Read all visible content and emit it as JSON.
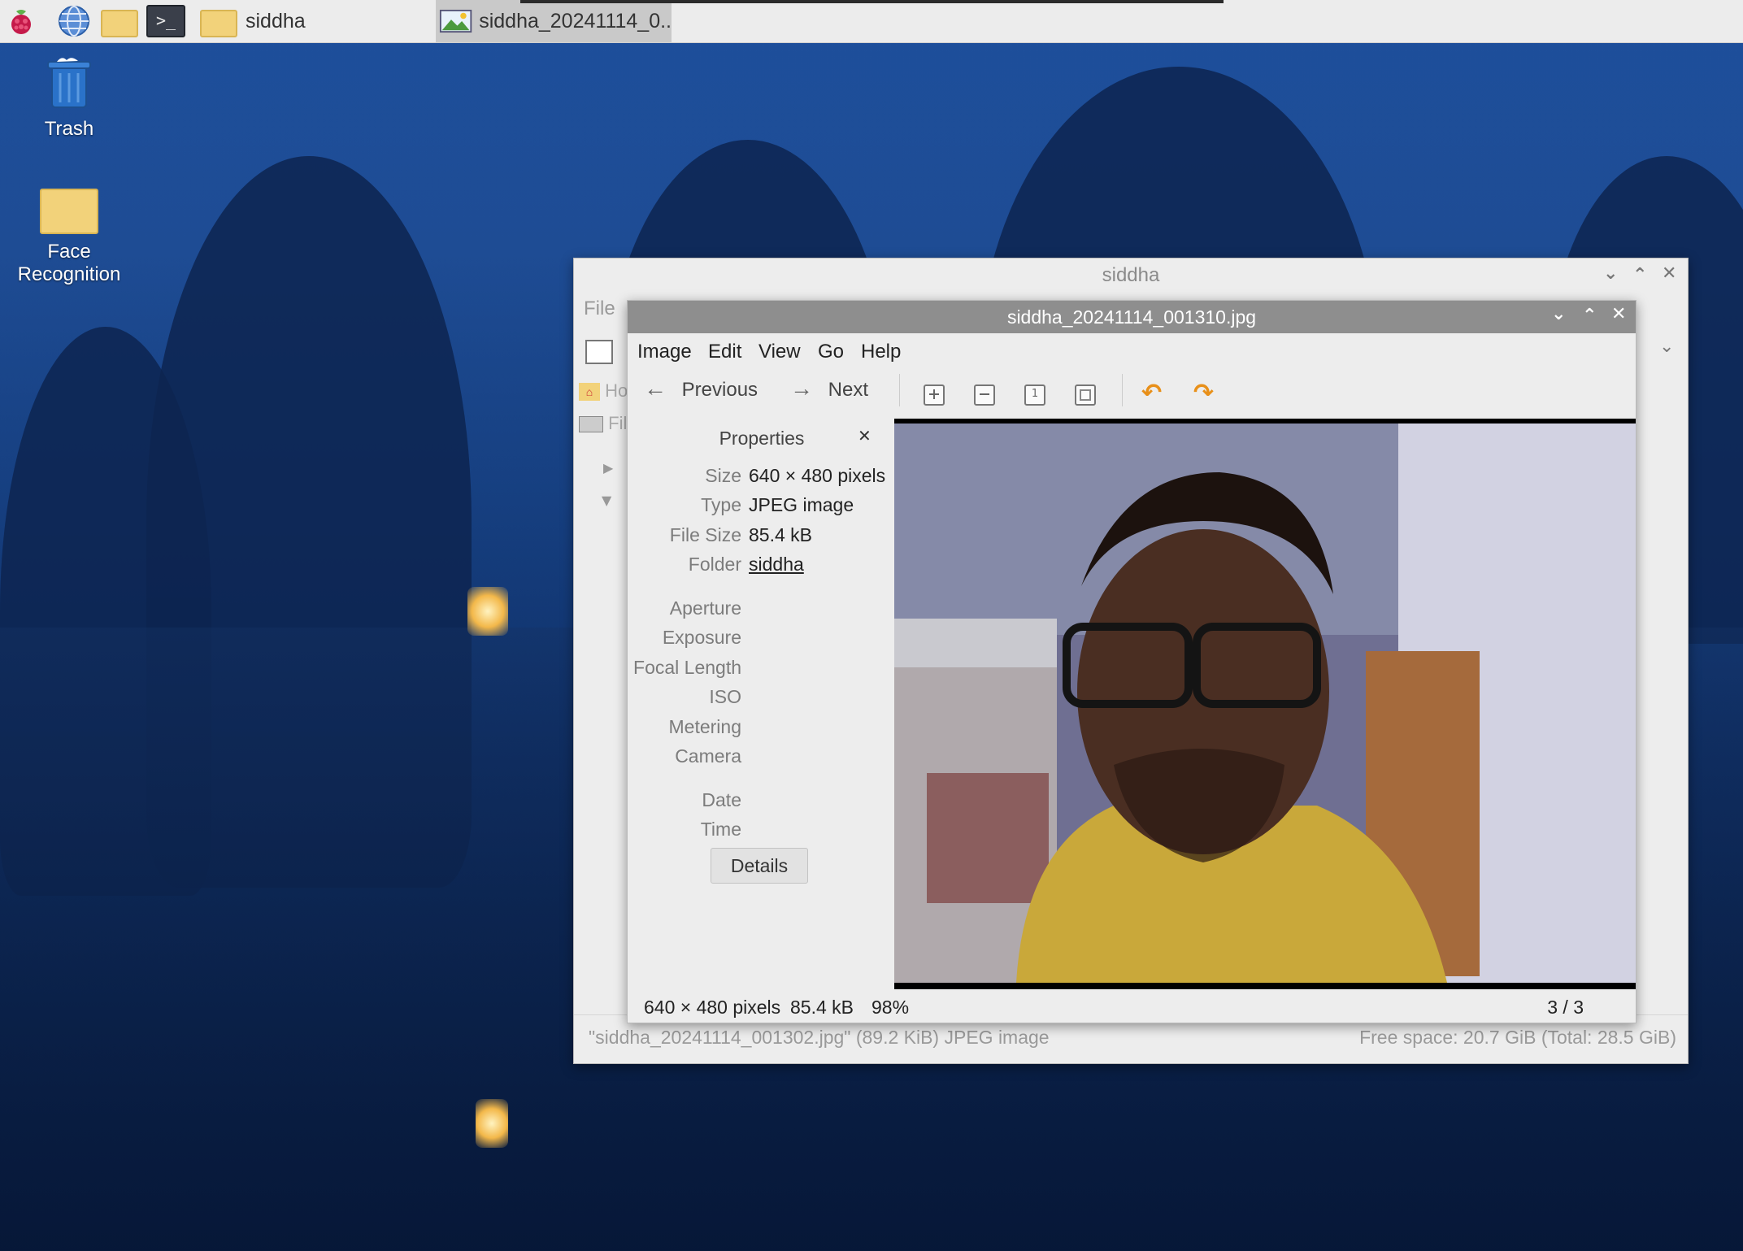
{
  "taskbar": {
    "active_folder": "siddha",
    "active_task": "siddha_20241114_0..",
    "icons": [
      "raspberry-menu-icon",
      "web-browser-icon",
      "file-manager-icon",
      "terminal-icon"
    ]
  },
  "desktop": {
    "trash_label": "Trash",
    "folder_label_line1": "Face",
    "folder_label_line2": "Recognition"
  },
  "file_manager": {
    "title": "siddha",
    "menu_file": "File",
    "sidebar_home": "Ho",
    "sidebar_fs": "Fil",
    "status_left": "\"siddha_20241114_001302.jpg\" (89.2 KiB) JPEG image",
    "status_right": "Free space: 20.7 GiB (Total: 28.5 GiB)"
  },
  "viewer": {
    "title": "siddha_20241114_001310.jpg",
    "menu": [
      "Image",
      "Edit",
      "View",
      "Go",
      "Help"
    ],
    "previous_label": "Previous",
    "next_label": "Next",
    "properties": {
      "heading": "Properties",
      "size_label": "Size",
      "size_value": "640 × 480 pixels",
      "type_label": "Type",
      "type_value": "JPEG image",
      "filesize_label": "File Size",
      "filesize_value": "85.4 kB",
      "folder_label": "Folder",
      "folder_value": "siddha",
      "aperture_label": "Aperture",
      "exposure_label": "Exposure",
      "focal_label": "Focal Length",
      "iso_label": "ISO",
      "metering_label": "Metering",
      "camera_label": "Camera",
      "date_label": "Date",
      "time_label": "Time",
      "details_button": "Details"
    },
    "status": {
      "dims": "640 × 480 pixels",
      "size": "85.4 kB",
      "zoom": "98%",
      "position": "3 / 3"
    }
  },
  "colors": {
    "desktop_top": "#1d4f9c",
    "desktop_bottom": "#0a1f45",
    "viewer_titlebar": "#8e8e8e",
    "rotate_icon": "#e8901a",
    "photo_bg": "#6a6b8c"
  }
}
